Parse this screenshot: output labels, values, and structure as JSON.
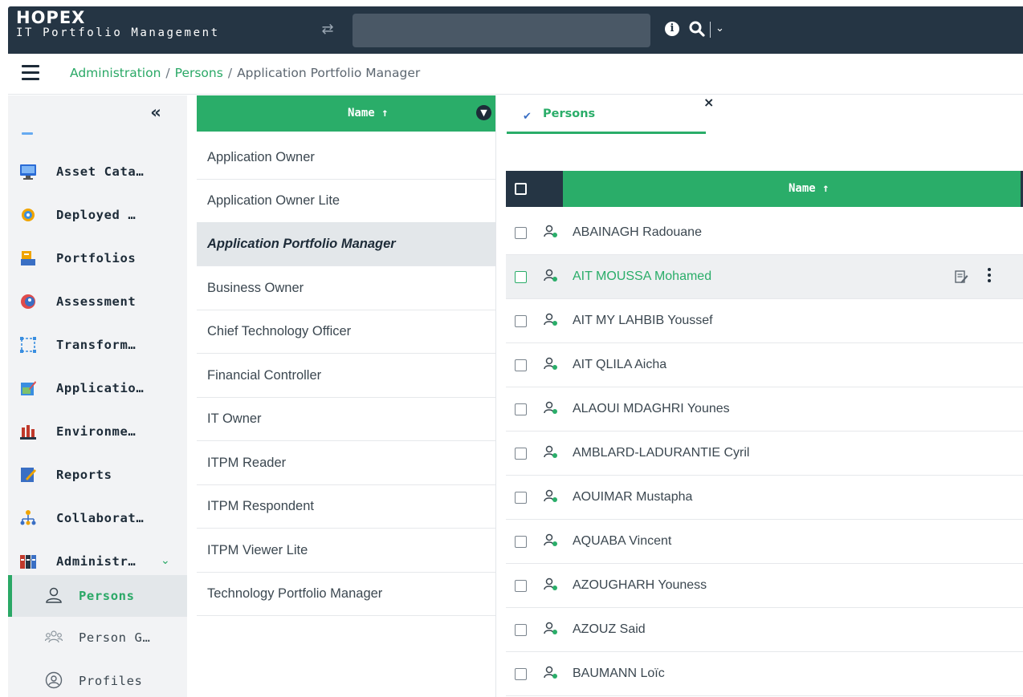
{
  "app": {
    "logo": "HOPEX",
    "subtitle": "IT Portfolio Management"
  },
  "topbar": {
    "search_value": "",
    "icons": [
      "swap-icon",
      "info-icon",
      "search-icon",
      "chevron-down-icon"
    ]
  },
  "breadcrumb": {
    "items": [
      "Administration",
      "Persons"
    ],
    "current": "Application Portfolio Manager",
    "separator": "/"
  },
  "sidebar": {
    "collapse_glyph": "«",
    "items": [
      {
        "label": "Asset Cata…",
        "icon": "monitor-icon",
        "color": "#2a6bd6"
      },
      {
        "label": "Deployed …",
        "icon": "gear-icon",
        "color": "#3a8ee0"
      },
      {
        "label": "Portfolios",
        "icon": "folder-icon",
        "color": "#f0a400"
      },
      {
        "label": "Assessment",
        "icon": "assessment-icon",
        "color": "#e04b4b"
      },
      {
        "label": "Transform…",
        "icon": "transform-icon",
        "color": "#3a8ee0"
      },
      {
        "label": "Applicatio…",
        "icon": "application-icon",
        "color": "#3a8ee0"
      },
      {
        "label": "Environme…",
        "icon": "environment-icon",
        "color": "#c0392b"
      },
      {
        "label": "Reports",
        "icon": "reports-icon",
        "color": "#3a6fc4"
      },
      {
        "label": "Collaborat…",
        "icon": "collaboration-icon",
        "color": "#f0a400"
      },
      {
        "label": "Administr…",
        "icon": "administration-icon",
        "color": "#c0392b",
        "expanded": true
      }
    ],
    "subitems": [
      {
        "label": "Persons",
        "icon": "person-icon",
        "active": true
      },
      {
        "label": "Person G…",
        "icon": "person-group-icon",
        "active": false
      },
      {
        "label": "Profiles",
        "icon": "profile-icon",
        "active": false
      }
    ]
  },
  "profiles": {
    "header": "Name",
    "sort_glyph": "↑",
    "items": [
      {
        "label": "Application Owner",
        "selected": false
      },
      {
        "label": "Application Owner Lite",
        "selected": false
      },
      {
        "label": "Application Portfolio Manager",
        "selected": true
      },
      {
        "label": "Business Owner",
        "selected": false
      },
      {
        "label": "Chief Technology Officer",
        "selected": false
      },
      {
        "label": "Financial Controller",
        "selected": false
      },
      {
        "label": "IT Owner",
        "selected": false
      },
      {
        "label": "ITPM Reader",
        "selected": false
      },
      {
        "label": "ITPM Respondent",
        "selected": false
      },
      {
        "label": "ITPM Viewer Lite",
        "selected": false
      },
      {
        "label": "Technology Portfolio Manager",
        "selected": false
      }
    ]
  },
  "persons": {
    "tab_label": "Persons",
    "tab_close": "×",
    "header": "Name",
    "sort_glyph": "↑",
    "rows": [
      {
        "name": "ABAINAGH Radouane",
        "hover": false
      },
      {
        "name": "AIT MOUSSA Mohamed",
        "hover": true
      },
      {
        "name": "AIT MY LAHBIB Youssef",
        "hover": false
      },
      {
        "name": "AIT QLILA Aicha",
        "hover": false
      },
      {
        "name": "ALAOUI MDAGHRI Younes",
        "hover": false
      },
      {
        "name": "AMBLARD-LADURANTIE Cyril",
        "hover": false
      },
      {
        "name": "AOUIMAR Mustapha",
        "hover": false
      },
      {
        "name": "AQUABA Vincent",
        "hover": false
      },
      {
        "name": "AZOUGHARH Youness",
        "hover": false
      },
      {
        "name": "AZOUZ Said",
        "hover": false
      },
      {
        "name": "BAUMANN Loïc",
        "hover": false
      }
    ]
  },
  "colors": {
    "topbar": "#253544",
    "accent_green": "#2aad69",
    "link_green": "#2aa866",
    "sidebar_bg": "#f2f3f5",
    "selected_bg": "#e3e7ea"
  }
}
